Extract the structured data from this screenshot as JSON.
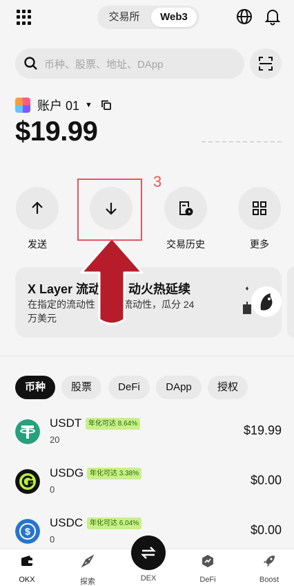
{
  "header": {
    "segments": [
      "交易所",
      "Web3"
    ],
    "active_segment": "Web3"
  },
  "search": {
    "placeholder": "币种、股票、地址、DApp"
  },
  "account": {
    "name": "账户 01",
    "balance": "$19.99"
  },
  "actions": [
    {
      "label": "发送",
      "icon": "arrow-up-icon"
    },
    {
      "label": "",
      "icon": "arrow-down-icon"
    },
    {
      "label": "交易历史",
      "icon": "history-icon"
    },
    {
      "label": "更多",
      "icon": "grid-icon"
    }
  ],
  "annotation": {
    "step": "3",
    "color": "#e4575a"
  },
  "banner": {
    "title": "X Layer 流动性",
    "title_tail": "动火热延续",
    "desc": "在指定的流动性",
    "desc_tail": "供流动性，瓜分 24",
    "desc_line2": "万美元"
  },
  "chips": [
    "币种",
    "股票",
    "DeFi",
    "DApp",
    "授权"
  ],
  "active_chip": "币种",
  "tokens": [
    {
      "symbol": "USDT",
      "apy": "年化可达 8.64%",
      "amount": "20",
      "value": "$19.99",
      "color": "#26a17b"
    },
    {
      "symbol": "USDG",
      "apy": "年化可达 3.38%",
      "amount": "0",
      "value": "$0.00",
      "color": "#111111"
    },
    {
      "symbol": "USDC",
      "apy": "年化可达 6.04%",
      "amount": "0",
      "value": "$0.00",
      "color": "#2775ca"
    }
  ],
  "tabbar": [
    "OKX",
    "探索",
    "DEX",
    "DeFi",
    "Boost"
  ],
  "colors": {
    "apy_bg": "#c7f08a",
    "apy_text": "#2d6a00"
  }
}
